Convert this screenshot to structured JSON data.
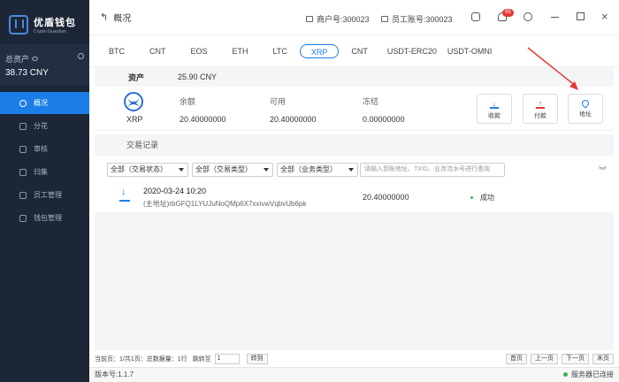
{
  "app": {
    "name": "优盾钱包",
    "subtitle": "Crypto Guardian"
  },
  "sidebar": {
    "assets_label": "总资产",
    "assets_value": "38.73 CNY",
    "items": [
      {
        "label": "概况"
      },
      {
        "label": "分花"
      },
      {
        "label": "审核"
      },
      {
        "label": "归集"
      },
      {
        "label": "员工管理"
      },
      {
        "label": "钱包管理"
      }
    ]
  },
  "header": {
    "title": "概况",
    "merchant": "商户号:300023",
    "staff": "员工账号:300023",
    "notification_count": "95"
  },
  "tabs": [
    "BTC",
    "CNT",
    "EOS",
    "ETH",
    "LTC",
    "XRP",
    "CNT",
    "USDT-ERC20",
    "USDT-OMNI"
  ],
  "active_tab": "XRP",
  "asset": {
    "label": "资产",
    "value": "25.90 CNY",
    "coin": "XRP",
    "balance_label": "余额",
    "balance": "20.40000000",
    "available_label": "可用",
    "available": "20.40000000",
    "frozen_label": "冻结",
    "frozen": "0.00000000",
    "actions": {
      "receive": "收款",
      "pay": "付款",
      "address": "地址"
    }
  },
  "transactions": {
    "title": "交易记录",
    "filters": {
      "status": "全部（交易状态）",
      "type": "全部（交易类型）",
      "business": "全部（业务类型）",
      "search_placeholder": "请输入到账地址、TXID、业务流水号进行查询"
    },
    "rows": [
      {
        "date": "2020-03-24 10:20",
        "address": "(主地址)rbGFQ1LYUJuNoQMp6X7xxivwVqbvUb6pk",
        "amount": "20.40000000",
        "status": "成功"
      }
    ]
  },
  "pager": {
    "summary": "当前页：1/共1页：总数据量：1行",
    "jump_label": "跳转至",
    "jump_value": "1",
    "jump_button": "转到",
    "first": "首页",
    "prev": "上一页",
    "next": "下一页",
    "last": "末页"
  },
  "footer": {
    "version": "版本号:1.1.7",
    "connection": "服务器已连接"
  }
}
